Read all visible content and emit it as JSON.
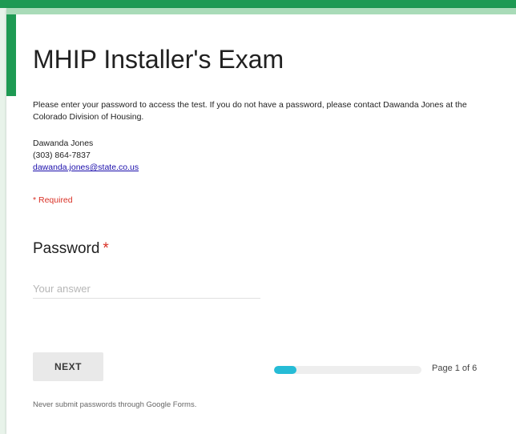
{
  "form": {
    "title": "MHIP Installer's Exam",
    "description": "Please enter your password to access the test. If you do not have a password, please contact Dawanda Jones at the Colorado Division of Housing.",
    "contact": {
      "name": "Dawanda Jones",
      "phone": "(303) 864-7837",
      "email": "dawanda.jones@state.co.us"
    },
    "required_note": "* Required"
  },
  "question": {
    "label": "Password",
    "required_marker": "*",
    "placeholder": "Your answer",
    "value": ""
  },
  "navigation": {
    "next_label": "NEXT",
    "progress": 0.15,
    "page_text": "Page 1 of 6"
  },
  "footer": {
    "note": "Never submit passwords through Google Forms."
  },
  "colors": {
    "header_green": "#1e9a53",
    "accent_light_green": "#a9dbb8",
    "progress_cyan": "#26bcd6",
    "required_red": "#d93025"
  }
}
